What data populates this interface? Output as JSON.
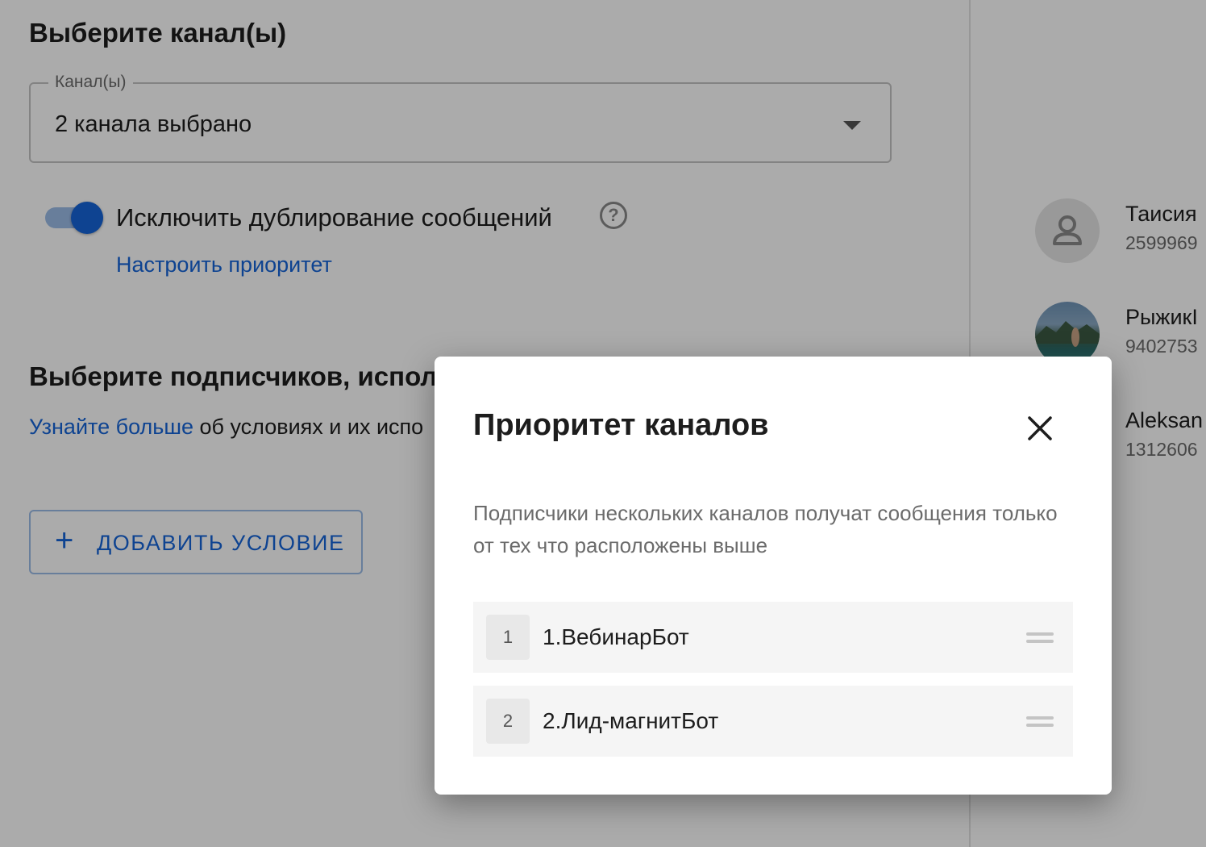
{
  "channels_section": {
    "title": "Выберите канал(ы)",
    "select": {
      "label": "Канал(ы)",
      "value": "2 канала выбрано"
    },
    "dedup_toggle": {
      "label": "Исключить дублирование сообщений",
      "checked": true
    },
    "priority_link": "Настроить приоритет"
  },
  "subscribers_section": {
    "title": "Выберите подписчиков, испол",
    "learn_more_link": "Узнайте больше",
    "learn_more_rest": " об условиях и их испо",
    "add_condition_button": "ДОБАВИТЬ УСЛОВИЕ"
  },
  "subscribers_list": [
    {
      "name": "Таисия",
      "id": "2599969",
      "avatar": "user-icon"
    },
    {
      "name": "РыжикI",
      "id": "9402753",
      "avatar": "photo"
    },
    {
      "name": "Aleksan",
      "id": "1312606",
      "avatar": "none"
    }
  ],
  "modal": {
    "title": "Приоритет каналов",
    "description": "Подписчики нескольких каналов получат сообщения только от тех что расположены выше",
    "channels": [
      {
        "index": "1",
        "name": "1.ВебинарБот"
      },
      {
        "index": "2",
        "name": "2.Лид-магнитБот"
      }
    ]
  },
  "colors": {
    "accent": "#1565d8",
    "toggle_track": "#9bbce8",
    "text_primary": "#1d1d1d",
    "text_secondary": "#6b6b6b",
    "overlay": "rgba(0,0,0,0.33)"
  }
}
